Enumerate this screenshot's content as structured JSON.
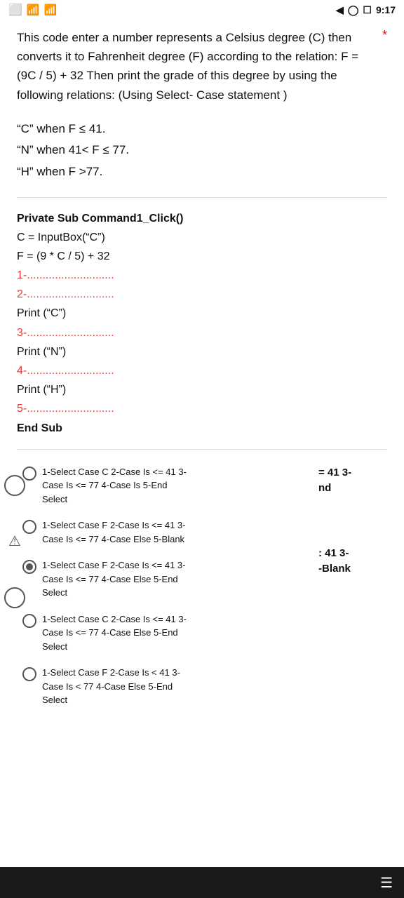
{
  "statusBar": {
    "time": "9:17",
    "icons": [
      "signal",
      "wifi",
      "location",
      "battery",
      "camera"
    ]
  },
  "header": {
    "description": "This code enter a number represents a Celsius degree (C) then converts it to Fahrenheit degree (F) according to the relation: F = (9C / 5) + 32 Then print the grade of this degree by using the following relations: (Using Select- Case statement )",
    "asterisk": "*"
  },
  "grades": [
    "“C” when F ≤ 41.",
    "“N” when 41< F ≤ 77.",
    "“H” when F >77."
  ],
  "code": {
    "line1": "Private Sub Command1_Click()",
    "line2": "C = InputBox(“C”)",
    "line3": "F = (9 * C / 5) + 32",
    "step1": "1-............................",
    "step2": "2-............................",
    "printC": "Print (“C”)",
    "step3": "3-............................",
    "printN": "Print (“N”)",
    "step4": "4-............................",
    "printH": "Print (“H”)",
    "step5": "5-............................",
    "endSub": "End Sub"
  },
  "options": [
    {
      "id": "opt1",
      "text": "1-Select Case C 2-Case Is <= 41 3-Case Is <= 77 4-Case Is 5-End Select",
      "selected": false
    },
    {
      "id": "opt2",
      "text": "1-Select Case F 2-Case Is <= 41 3-Case Is <= 77 4-Case Else 5-Blank",
      "selected": false
    },
    {
      "id": "opt3",
      "text": "1-Select Case F 2-Case Is <= 41 3-Case Is <= 77 4-Case Else 5-End Select",
      "selected": true
    },
    {
      "id": "opt4",
      "text": "1-Select Case C 2-Case Is <= 41 3-Case Is <= 77 4-Case Else 5-End Select",
      "selected": false
    },
    {
      "id": "opt5",
      "text": "1-Select Case F 2-Case Is < 41 3-Case Is < 77 4-Case Else 5-End Select",
      "selected": false
    }
  ],
  "rightLabels": [
    "= 41 3-\nnd",
    ": 41 3-\n-Blank"
  ],
  "bottomNav": {
    "menuIcon": "☰"
  }
}
